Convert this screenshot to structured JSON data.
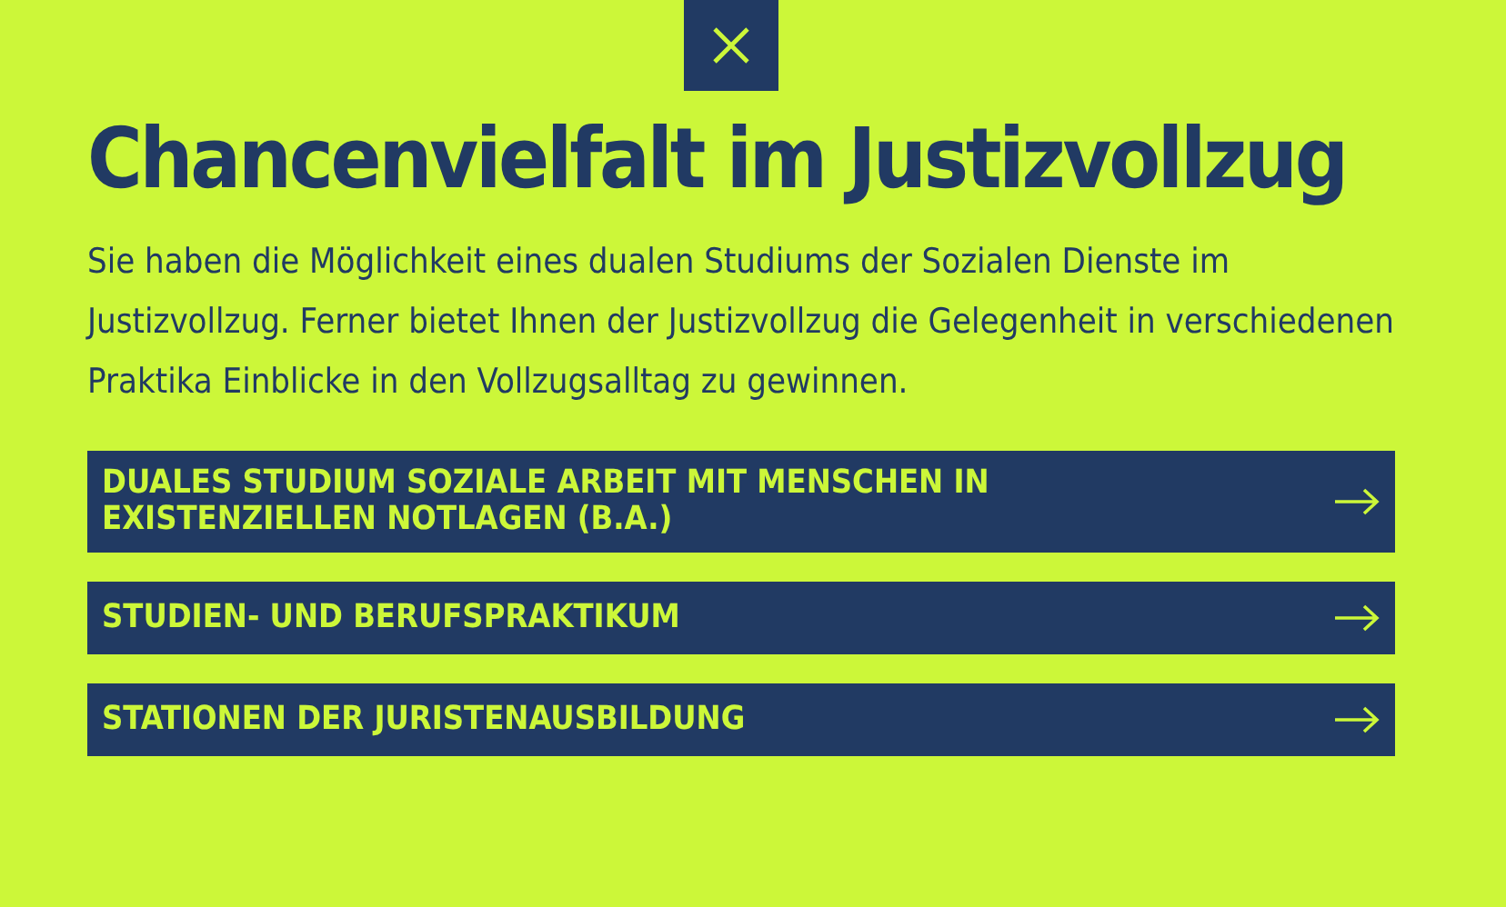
{
  "title": "Chancenvielfalt im Justizvollzug",
  "text": "Sie haben die Möglichkeit eines dualen Studiums der Sozialen Dienste im Justizvollzug. Ferner bietet Ihnen der Justizvollzug die Gelegenheit in verschiedenen Praktika Einblicke in den Vollzugsalltag zu gewinnen.",
  "links": [
    {
      "label": "DUALES STUDIUM SOZIALE ARBEIT MIT MENSCHEN IN EXISTENZIELLEN NOTLAGEN (B.A.)"
    },
    {
      "label": "STUDIEN- UND BERUFSPRAKTIKUM"
    },
    {
      "label": "STATIONEN DER JURISTENAUSBILDUNG"
    }
  ]
}
